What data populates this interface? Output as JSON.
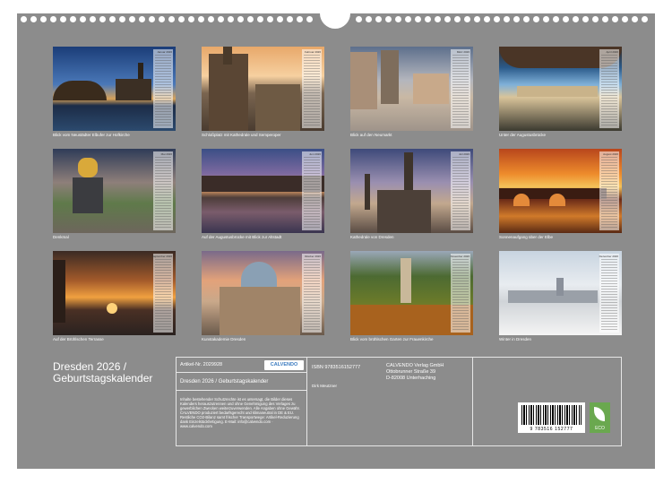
{
  "tiles": [
    {
      "caption": "Blick vom Neustädter Elbufer zur Hofkirche",
      "month": "Januar 2026"
    },
    {
      "caption": "Schloßplatz mit Kathedrale und Semperoper",
      "month": "Februar 2026"
    },
    {
      "caption": "Blick auf den Neumarkt",
      "month": "März 2026"
    },
    {
      "caption": "Unter der Augustusbrücke",
      "month": "April 2026"
    },
    {
      "caption": "Denkmal",
      "month": "Mai 2026"
    },
    {
      "caption": "Auf der Augustusbrücke mit Blick zur Altstadt",
      "month": "Juni 2026"
    },
    {
      "caption": "Kathedrale von Dresden",
      "month": "Juli 2026"
    },
    {
      "caption": "Sonnenaufgang über der Elbe",
      "month": "August 2026"
    },
    {
      "caption": "Auf der Brühlschen Terrasse",
      "month": "September 2026"
    },
    {
      "caption": "Kunstakademie Dresden",
      "month": "Oktober 2026"
    },
    {
      "caption": "Blick vom brühlschen Garten zur Frauenkirche",
      "month": "November 2026"
    },
    {
      "caption": "Winter in Dresden",
      "month": "Dezember 2026"
    }
  ],
  "title": {
    "line1": "Dresden 2026 /",
    "line2": "Geburtstagskalender"
  },
  "info": {
    "article": "Artikel-Nr. 2029928",
    "logo": "CALVENDO",
    "product_title": "Dresden 2026 / Geburtstagskalender",
    "legal": "Inhalte bestehender Schutzrechte ist es untersagt, die Bilder dieses Kalenders herauszutrennen und ohne Genehmigung des Verlages zu gewerblichen Zwecken weiterzuverwenden. Alle Angaben ohne Gewähr. CALVENDO produziert bedarfsgerecht und klimaneutral in DE & EU. Restliche CO2-Bilanz samt frischer Transportwege: Artikel-Reduzierung dank Einzelstückfertigung. E-Mail: info@calvendo.com · www.calvendo.com",
    "isbn": "ISBN 9783516152777",
    "author": "Dirk Meutzner",
    "publisher_name": "CALVENDO Verlag GmbH",
    "publisher_street": "Ottobrunner Straße 39",
    "publisher_city": "D-82008 Unterhaching",
    "barcode_number": "9 783516 152777",
    "eco_label": "ECO"
  },
  "colors": {
    "sheet": "#8c8c8c",
    "text": "#ffffff",
    "eco": "#6aa84f"
  }
}
